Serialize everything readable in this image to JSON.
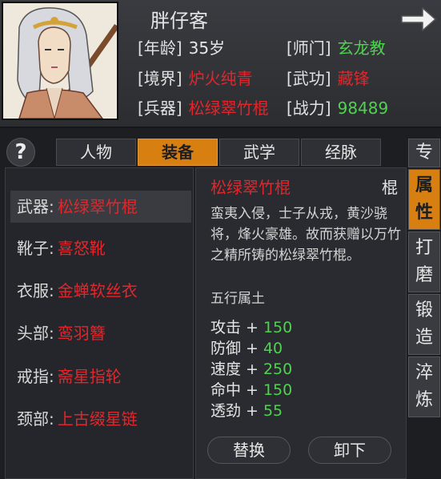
{
  "character": {
    "name": "胖仔客",
    "stats": {
      "age": {
        "label": "[年龄]",
        "value": "35岁"
      },
      "sect": {
        "label": "[师门]",
        "value": "玄龙教"
      },
      "realm": {
        "label": "[境界]",
        "value": "炉火纯青"
      },
      "skill": {
        "label": "[武功]",
        "value": "藏锋"
      },
      "weapon": {
        "label": "[兵器]",
        "value": "松绿翠竹棍"
      },
      "power": {
        "label": "[战力]",
        "value": "98489"
      }
    }
  },
  "help": {
    "label": "?"
  },
  "tabs": [
    {
      "label": "人物",
      "active": false
    },
    {
      "label": "装备",
      "active": true
    },
    {
      "label": "武学",
      "active": false
    },
    {
      "label": "经脉",
      "active": false
    }
  ],
  "side_tabs": [
    {
      "chars": [
        "专"
      ],
      "active": false
    },
    {
      "chars": [
        "属",
        "性"
      ],
      "active": true
    },
    {
      "chars": [
        "打",
        "磨"
      ],
      "active": false
    },
    {
      "chars": [
        "锻",
        "造"
      ],
      "active": false
    },
    {
      "chars": [
        "淬",
        "炼"
      ],
      "active": false
    }
  ],
  "slots": [
    {
      "label": "武器:",
      "value": "松绿翠竹棍",
      "selected": true
    },
    {
      "label": "靴子:",
      "value": "喜怒靴",
      "selected": false
    },
    {
      "label": "衣服:",
      "value": "金蝉软丝衣",
      "selected": false
    },
    {
      "label": "头部:",
      "value": "鸾羽簪",
      "selected": false
    },
    {
      "label": "戒指:",
      "value": "斋星指轮",
      "selected": false
    },
    {
      "label": "颈部:",
      "value": "上古缀星链",
      "selected": false
    }
  ],
  "item": {
    "name": "松绿翠竹棍",
    "type": "棍",
    "description": "蛮夷入侵，士子从戎，黄沙骁将，烽火豪雄。故而获赠以万竹之精所铸的松绿翠竹棍。",
    "element": "五行属土",
    "attributes": [
      {
        "label": "攻击",
        "value": "150"
      },
      {
        "label": "防御",
        "value": "40"
      },
      {
        "label": "速度",
        "value": "250"
      },
      {
        "label": "命中",
        "value": "150"
      },
      {
        "label": "透劲",
        "value": "55"
      }
    ]
  },
  "buttons": {
    "replace": "替换",
    "unequip": "卸下"
  },
  "colors": {
    "accent": "#d77f11",
    "item_red": "#e2262c",
    "stat_green": "#4fd24f"
  }
}
